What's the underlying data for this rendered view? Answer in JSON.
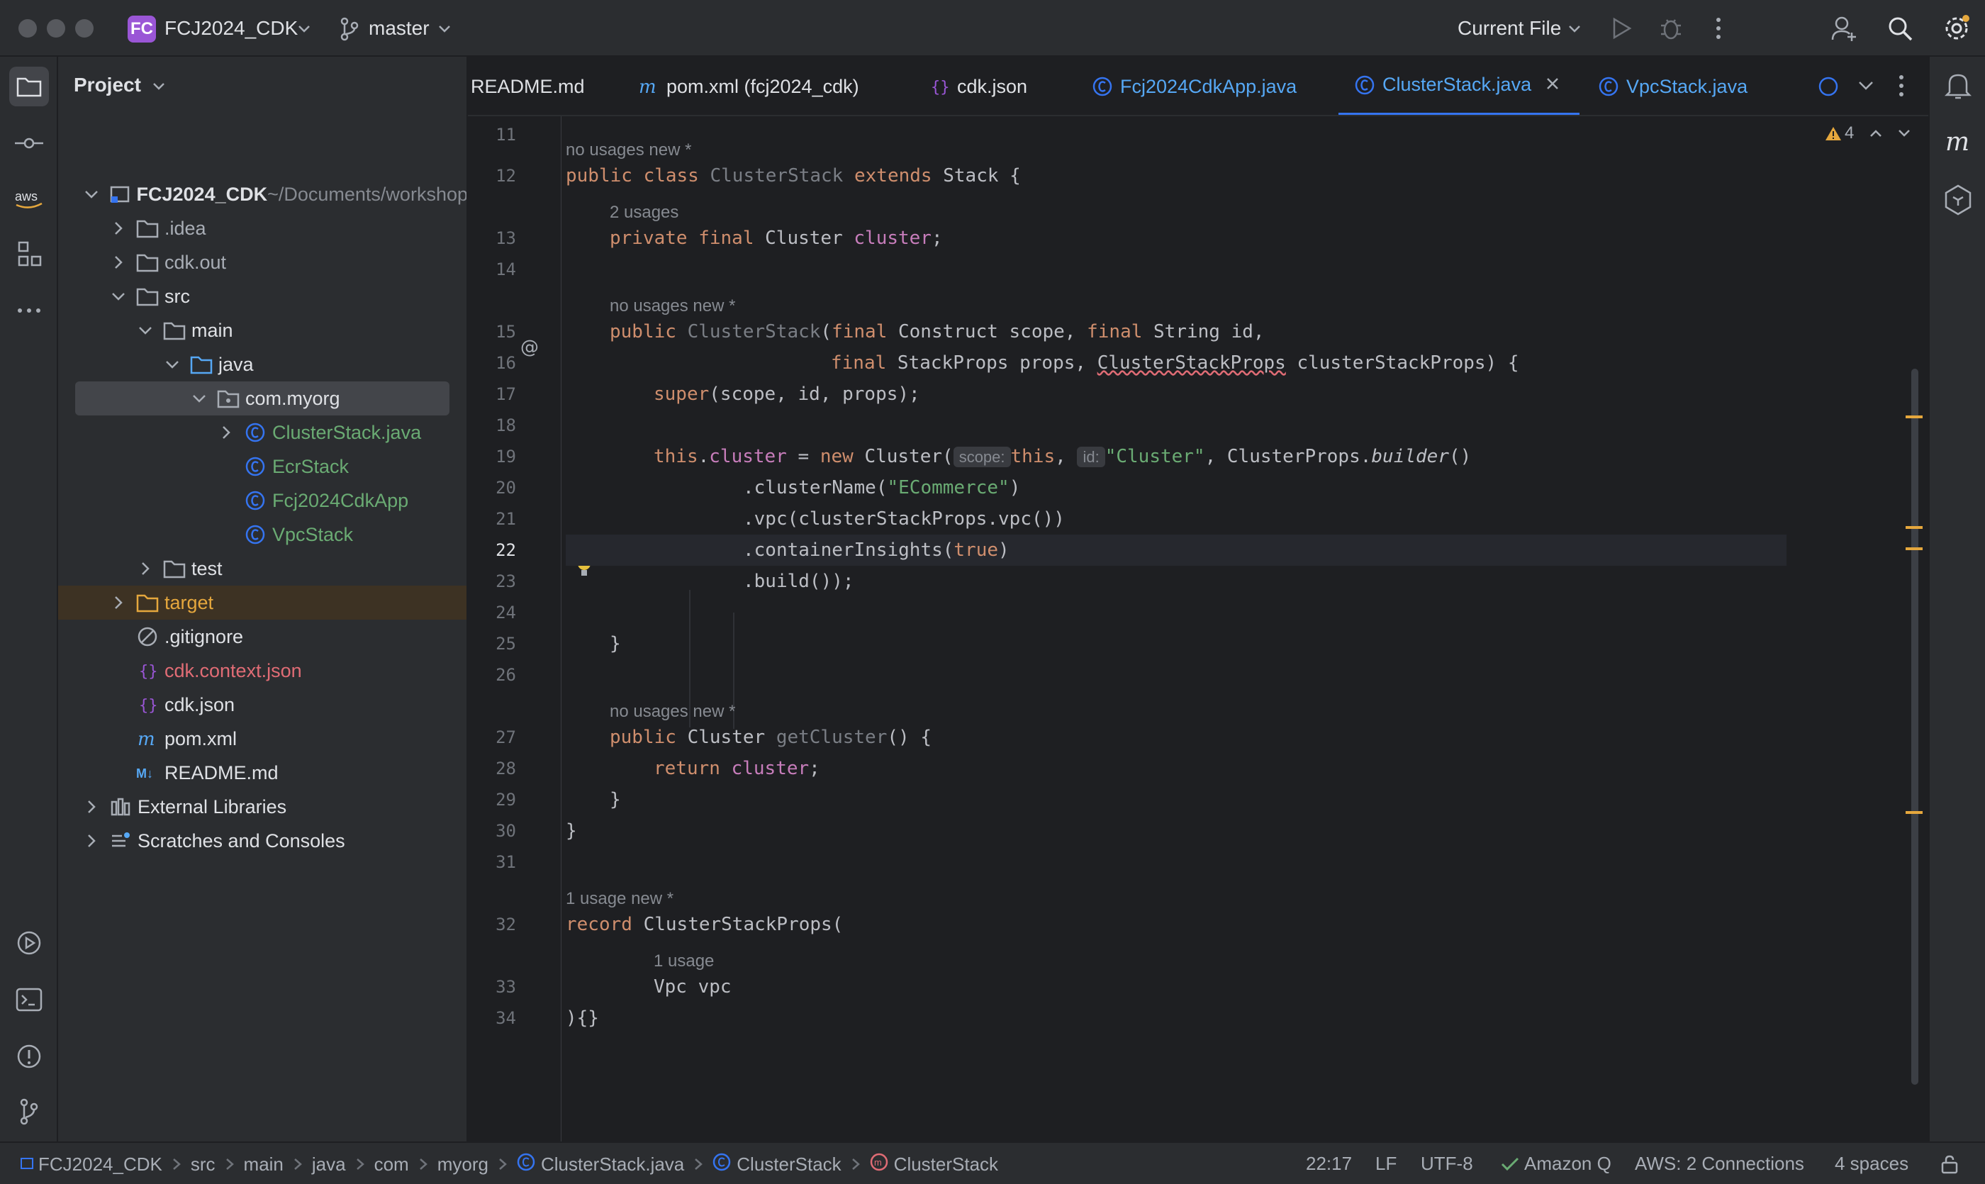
{
  "titlebar": {
    "project_badge": "FC",
    "project_name": "FCJ2024_CDK",
    "branch": "master",
    "run_config": "Current File"
  },
  "project_panel": {
    "title": "Project",
    "tree": [
      {
        "label": "FCJ2024_CDK",
        "suffix": " ~/Documents/workshop",
        "kind": "module",
        "color": "#dfe1e5",
        "bold": true
      },
      {
        "label": ".idea",
        "kind": "folder",
        "color": "#a8adb5"
      },
      {
        "label": "cdk.out",
        "kind": "folder",
        "color": "#a8adb5"
      },
      {
        "label": "src",
        "kind": "folder",
        "color": "#dfe1e5"
      },
      {
        "label": "main",
        "kind": "folder",
        "color": "#dfe1e5"
      },
      {
        "label": "java",
        "kind": "folder-blue",
        "color": "#dfe1e5"
      },
      {
        "label": "com.myorg",
        "kind": "package",
        "color": "#dfe1e5"
      },
      {
        "label": "ClusterStack.java",
        "kind": "class",
        "color": "#6aab73"
      },
      {
        "label": "EcrStack",
        "kind": "class",
        "color": "#6aab73"
      },
      {
        "label": "Fcj2024CdkApp",
        "kind": "class",
        "color": "#6aab73"
      },
      {
        "label": "VpcStack",
        "kind": "class",
        "color": "#6aab73"
      },
      {
        "label": "test",
        "kind": "folder",
        "color": "#dfe1e5"
      },
      {
        "label": "target",
        "kind": "folder-orange",
        "color": "#e5a73d"
      },
      {
        "label": ".gitignore",
        "kind": "ignore",
        "color": "#dfe1e5"
      },
      {
        "label": "cdk.context.json",
        "kind": "json",
        "color": "#e06c75"
      },
      {
        "label": "cdk.json",
        "kind": "json",
        "color": "#dfe1e5"
      },
      {
        "label": "pom.xml",
        "kind": "maven",
        "color": "#dfe1e5"
      },
      {
        "label": "README.md",
        "kind": "markdown",
        "color": "#dfe1e5"
      },
      {
        "label": "External Libraries",
        "kind": "libs",
        "color": "#dfe1e5"
      },
      {
        "label": "Scratches and Consoles",
        "kind": "scratch",
        "color": "#dfe1e5"
      }
    ]
  },
  "tabs": [
    {
      "label": "README.md",
      "icon": "markdown-icon",
      "color": "#dfe1e5"
    },
    {
      "label": "pom.xml (fcj2024_cdk)",
      "icon": "maven-icon",
      "color": "#dfe1e5"
    },
    {
      "label": "cdk.json",
      "icon": "json-icon",
      "color": "#dfe1e5"
    },
    {
      "label": "Fcj2024CdkApp.java",
      "icon": "class-icon",
      "color": "#56a8f5"
    },
    {
      "label": "ClusterStack.java",
      "icon": "class-icon",
      "color": "#56a8f5"
    },
    {
      "label": "VpcStack.java",
      "icon": "class-icon",
      "color": "#56a8f5"
    }
  ],
  "editor": {
    "warnings_count": "4",
    "line_numbers": [
      "11",
      "12",
      "13",
      "14",
      "15",
      "16",
      "17",
      "18",
      "19",
      "20",
      "21",
      "22",
      "23",
      "24",
      "25",
      "26",
      "27",
      "28",
      "29",
      "30",
      "31",
      "32",
      "33",
      "34"
    ],
    "current_line": "22",
    "hints": {
      "h1": "no usages   new *",
      "h2": "2 usages",
      "h3": "no usages   new *",
      "h4": "no usages   new *",
      "h5": "1 usage   new *",
      "h6": "1 usage"
    },
    "code": {
      "l12_a": "public class ",
      "l12_b": "ClusterStack ",
      "l12_c": "extends ",
      "l12_d": "Stack {",
      "l13_a": "private final ",
      "l13_b": "Cluster ",
      "l13_c": "cluster",
      "l13_d": ";",
      "l15_a": "public ",
      "l15_b": "ClusterStack",
      "l15_c": "(",
      "l15_d": "final ",
      "l15_e": "Construct scope, ",
      "l15_f": "final ",
      "l15_g": "String id,",
      "l16_a": "final ",
      "l16_b": "StackProps props, ",
      "l16_c": "ClusterStackProps",
      "l16_d": " clusterStackProps) {",
      "l17_a": "super",
      "l17_b": "(scope, id, props);",
      "l19_a": "this",
      "l19_b": ".",
      "l19_c": "cluster",
      "l19_d": " = ",
      "l19_e": "new ",
      "l19_f": "Cluster(",
      "l19_g": "scope:",
      "l19_h": "this",
      "l19_i": ", ",
      "l19_j": "id:",
      "l19_k": "\"Cluster\"",
      "l19_l": ", ClusterProps.",
      "l19_m": "builder",
      "l19_n": "()",
      "l20_a": ".clusterName(",
      "l20_b": "\"ECommerce\"",
      "l20_c": ")",
      "l21_a": ".vpc(clusterStackProps.vpc())",
      "l22_a": ".containerInsights(",
      "l22_b": "true",
      "l22_c": ")",
      "l23_a": ".build());",
      "l25_a": "}",
      "l27_a": "public ",
      "l27_b": "Cluster ",
      "l27_c": "getCluster",
      "l27_d": "() {",
      "l28_a": "return ",
      "l28_b": "cluster",
      "l28_c": ";",
      "l29_a": "}",
      "l30_a": "}",
      "l32_a": "record ",
      "l32_b": "ClusterStackProps(",
      "l33_a": "Vpc vpc",
      "l34_a": "){}"
    }
  },
  "breadcrumb": [
    "FCJ2024_CDK",
    "src",
    "main",
    "java",
    "com",
    "myorg",
    "ClusterStack.java",
    "ClusterStack",
    "ClusterStack"
  ],
  "status": {
    "position": "22:17",
    "line_sep": "LF",
    "encoding": "UTF-8",
    "amazon_q": "Amazon Q",
    "aws": "AWS: 2 Connections",
    "indent": "4 spaces"
  },
  "colors": {
    "accent": "#3574f0",
    "string": "#6aab73",
    "keyword": "#cf8e6d",
    "field": "#c77dbb",
    "method": "#56a8f5",
    "warning": "#e5a73d"
  }
}
